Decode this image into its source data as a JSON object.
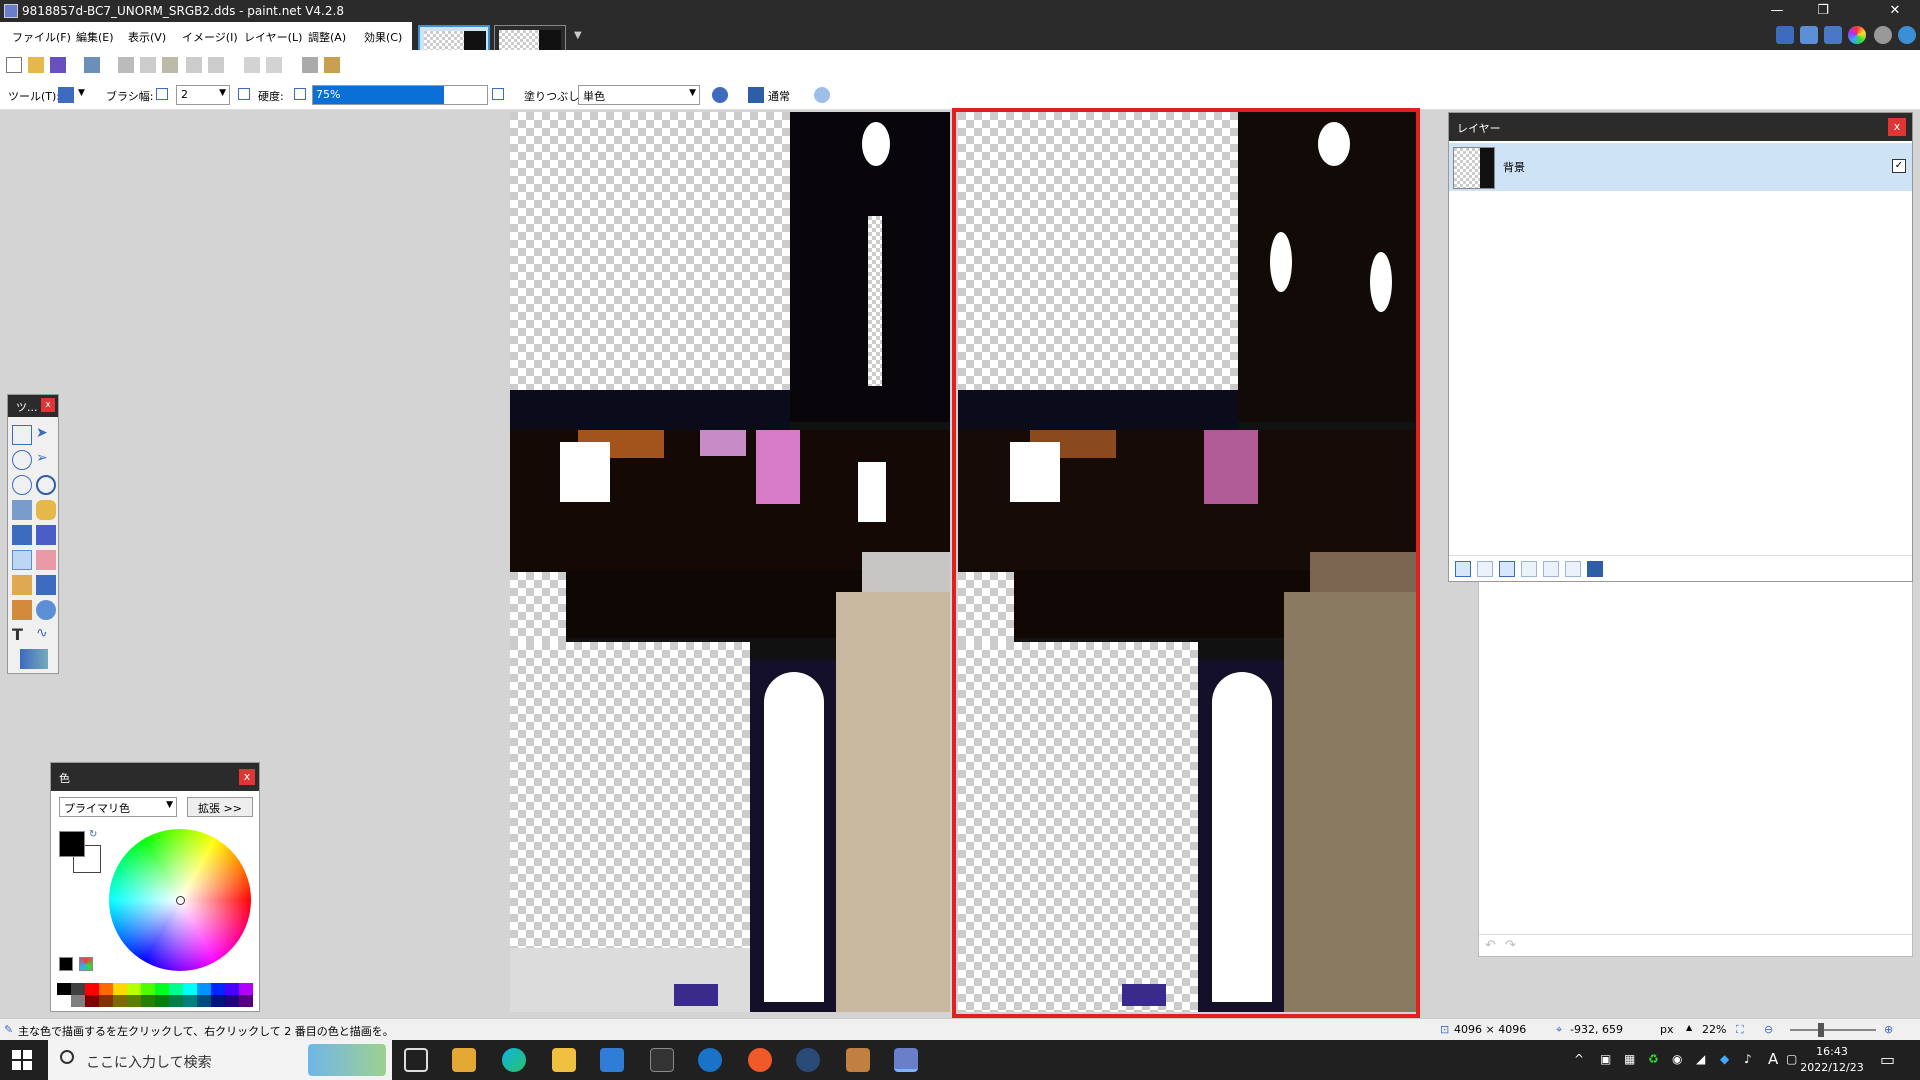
{
  "window": {
    "title": "9818857d-BC7_UNORM_SRGB2.dds - paint.net V4.2.8",
    "minimize": "—",
    "restore": "❐",
    "close": "✕"
  },
  "menu": {
    "file": "ファイル(F)",
    "edit": "編集(E)",
    "view": "表示(V)",
    "image": "イメージ(I)",
    "layers": "レイヤー(L)",
    "adjustments": "調整(A)",
    "effects": "効果(C)"
  },
  "toolbar": {
    "tool_label": "ツール(T):",
    "brush_width_label": "ブラシ幅:",
    "brush_width_value": "2",
    "hardness_label": "硬度:",
    "hardness_value": "75%",
    "hardness_fraction": 0.75,
    "fill_label": "塗りつぶし:",
    "fill_value": "単色",
    "blend_mode": "通常"
  },
  "tools_panel": {
    "title": "ツ..."
  },
  "layers_panel": {
    "title": "レイヤー",
    "layers": [
      {
        "name": "背景",
        "visible": true
      }
    ]
  },
  "colors_panel": {
    "title": "色",
    "mode": "プライマリ色",
    "expand_button": "拡張 >>",
    "primary_color": "#000000",
    "secondary_color": "#ffffff"
  },
  "status": {
    "hint": "主な色で描画するを左クリックして、右クリックして 2 番目の色と描画を。",
    "image_size": "4096 × 4096",
    "cursor_pos": "-932, 659",
    "units": "px",
    "zoom": "22%"
  },
  "taskbar": {
    "search_placeholder": "ここに入力して検索",
    "time": "16:43",
    "date": "2022/12/23",
    "ime": "A"
  },
  "colors": {
    "accent": "#0a6fd6",
    "selection_border": "#e21f1f",
    "layer_selected_bg": "#cfe3f7",
    "title_bar": "#2b2b2b"
  }
}
